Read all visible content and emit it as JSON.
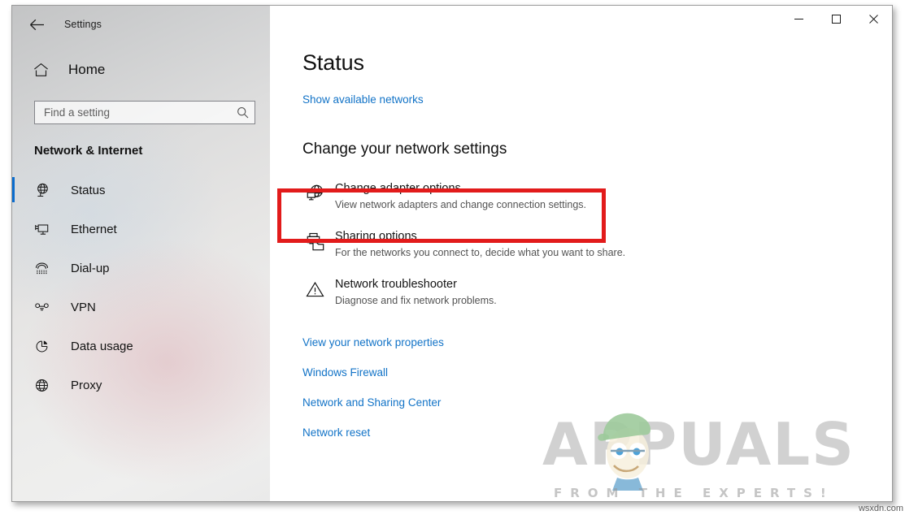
{
  "window": {
    "titlebar_label": "Settings",
    "back_icon": "back-arrow-icon",
    "controls": {
      "minimize": "minimize-icon",
      "maximize": "maximize-icon",
      "close": "close-icon"
    }
  },
  "sidebar": {
    "home": {
      "label": "Home",
      "icon": "home-icon"
    },
    "search": {
      "value": "",
      "placeholder": "Find a setting",
      "icon": "search-icon"
    },
    "category_title": "Network & Internet",
    "accent_color": "#0a6cce",
    "items": [
      {
        "label": "Status",
        "icon": "globe-network-icon",
        "selected": true
      },
      {
        "label": "Ethernet",
        "icon": "ethernet-icon",
        "selected": false
      },
      {
        "label": "Dial-up",
        "icon": "dialup-phone-icon",
        "selected": false
      },
      {
        "label": "VPN",
        "icon": "vpn-key-icon",
        "selected": false
      },
      {
        "label": "Data usage",
        "icon": "pie-chart-icon",
        "selected": false
      },
      {
        "label": "Proxy",
        "icon": "globe-icon",
        "selected": false
      }
    ]
  },
  "main": {
    "page_title": "Status",
    "show_networks_link": "Show available networks",
    "section_heading": "Change your network settings",
    "link_color": "#1273c7",
    "options": [
      {
        "title": "Change adapter options",
        "desc": "View network adapters and change connection settings.",
        "icon": "network-adapter-icon",
        "highlighted": true
      },
      {
        "title": "Sharing options",
        "desc": "For the networks you connect to, decide what you want to share.",
        "icon": "printer-share-icon",
        "highlighted": false
      },
      {
        "title": "Network troubleshooter",
        "desc": "Diagnose and fix network problems.",
        "icon": "warning-triangle-icon",
        "highlighted": false
      }
    ],
    "links": [
      "View your network properties",
      "Windows Firewall",
      "Network and Sharing Center",
      "Network reset"
    ]
  },
  "annotation": {
    "highlight_color": "#e21b1b"
  },
  "watermark": {
    "brand": "APPUALS",
    "tagline": "FROM THE EXPERTS!",
    "source": "wsxdn.com"
  }
}
